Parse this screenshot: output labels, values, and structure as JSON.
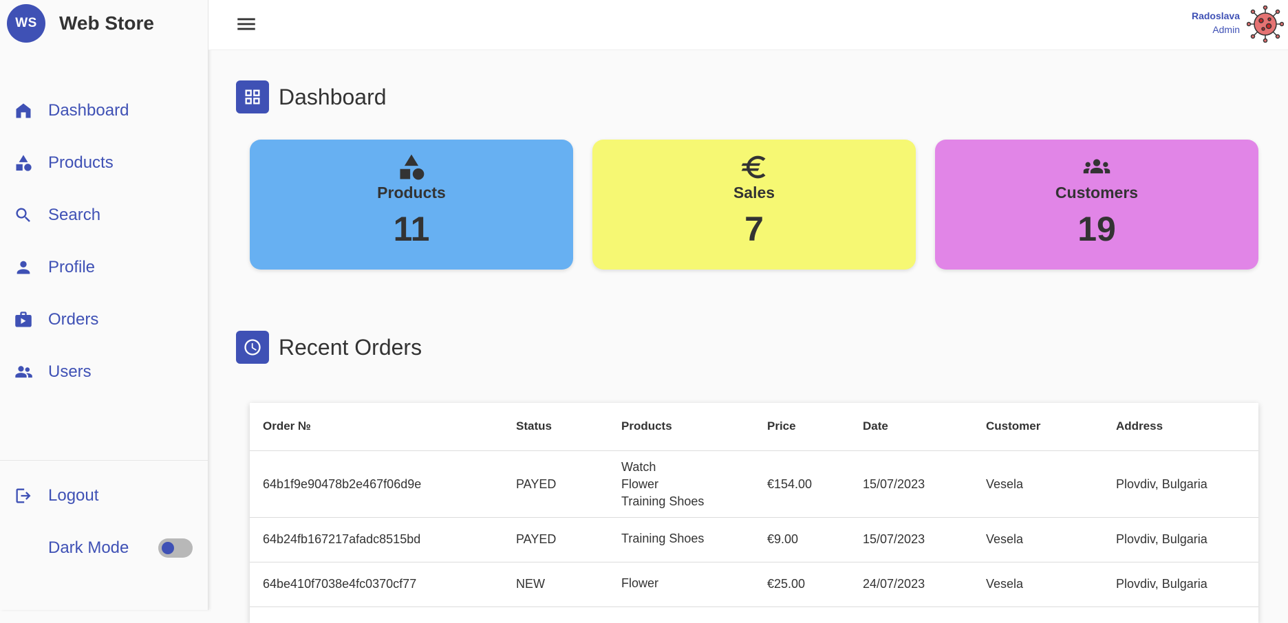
{
  "brand": {
    "logo": "WS",
    "name": "Web Store"
  },
  "nav": [
    {
      "label": "Dashboard",
      "icon": "home-icon"
    },
    {
      "label": "Products",
      "icon": "category-icon"
    },
    {
      "label": "Search",
      "icon": "search-icon"
    },
    {
      "label": "Profile",
      "icon": "person-icon"
    },
    {
      "label": "Orders",
      "icon": "orders-icon"
    },
    {
      "label": "Users",
      "icon": "group-icon"
    }
  ],
  "bottom_nav": {
    "logout_label": "Logout",
    "dark_mode_label": "Dark Mode",
    "dark_mode_on": false
  },
  "user": {
    "name": "Radoslava",
    "role": "Admin",
    "avatar_icon": "virus-avatar-icon"
  },
  "dashboard": {
    "title": "Dashboard",
    "cards": [
      {
        "label": "Products",
        "value": "11",
        "icon": "category-icon",
        "color": "#67b0f2"
      },
      {
        "label": "Sales",
        "value": "7",
        "icon": "euro-icon",
        "color": "#f6f873"
      },
      {
        "label": "Customers",
        "value": "19",
        "icon": "group-icon",
        "color": "#e185e7"
      }
    ]
  },
  "recent_orders": {
    "title": "Recent Orders",
    "columns": [
      "Order №",
      "Status",
      "Products",
      "Price",
      "Date",
      "Customer",
      "Address"
    ],
    "rows": [
      {
        "order": "64b1f9e90478b2e467f06d9e",
        "status": "PAYED",
        "products": [
          "Watch",
          "Flower",
          "Training Shoes"
        ],
        "price": "€154.00",
        "date": "15/07/2023",
        "customer": "Vesela",
        "address": "Plovdiv, Bulgaria"
      },
      {
        "order": "64b24fb167217afadc8515bd",
        "status": "PAYED",
        "products": [
          "Training Shoes"
        ],
        "price": "€9.00",
        "date": "15/07/2023",
        "customer": "Vesela",
        "address": "Plovdiv, Bulgaria"
      },
      {
        "order": "64be410f7038e4fc0370cf77",
        "status": "NEW",
        "products": [
          "Flower"
        ],
        "price": "€25.00",
        "date": "24/07/2023",
        "customer": "Vesela",
        "address": "Plovdiv, Bulgaria"
      }
    ]
  },
  "colors": {
    "accent": "#3f51b5"
  }
}
